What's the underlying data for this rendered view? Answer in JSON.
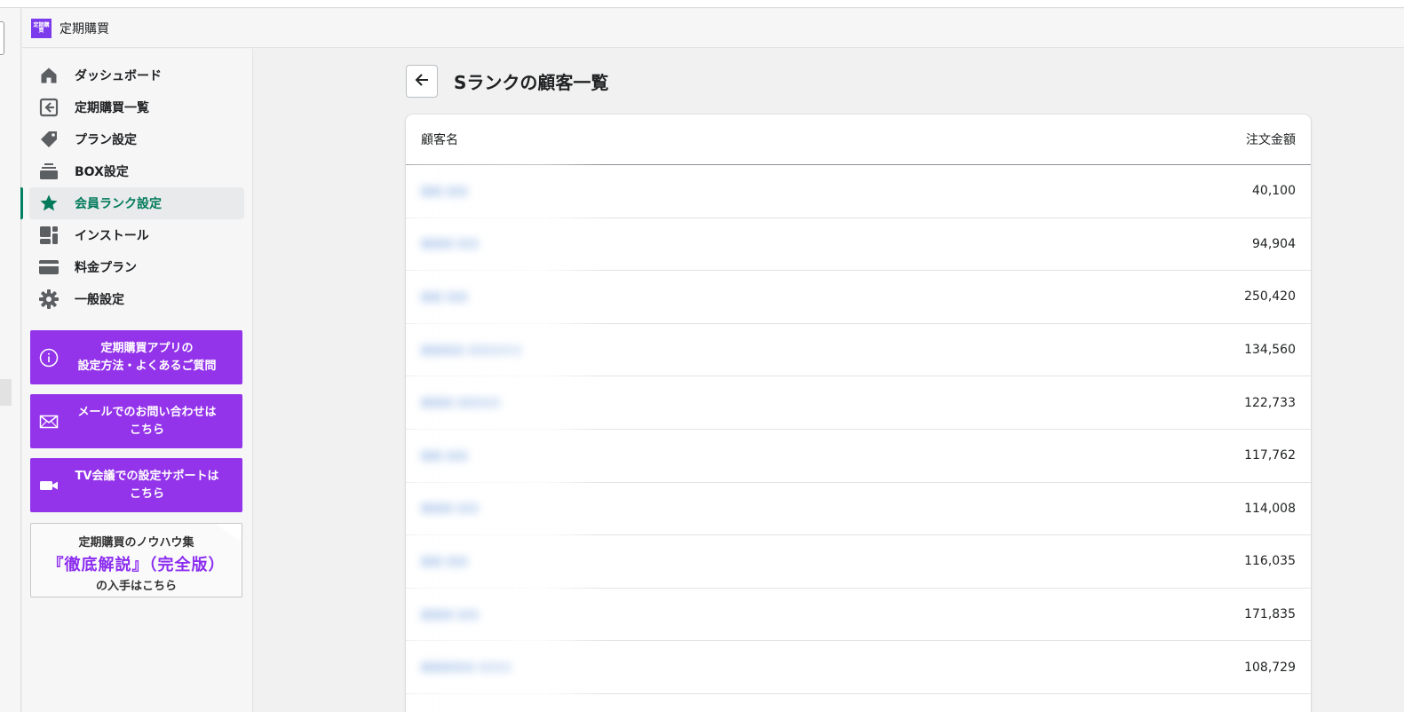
{
  "app": {
    "title": "定期購買",
    "logo_text": "定期購買"
  },
  "nav": {
    "items": [
      {
        "label": "ダッシュボード",
        "icon": "home-icon"
      },
      {
        "label": "定期購買一覧",
        "icon": "subscription-list-icon"
      },
      {
        "label": "プラン設定",
        "icon": "tag-icon"
      },
      {
        "label": "BOX設定",
        "icon": "box-stack-icon"
      },
      {
        "label": "会員ランク設定",
        "icon": "star-icon",
        "active": true
      },
      {
        "label": "インストール",
        "icon": "layout-icon"
      },
      {
        "label": "料金プラン",
        "icon": "credit-card-icon"
      },
      {
        "label": "一般設定",
        "icon": "gear-icon"
      }
    ]
  },
  "promos": {
    "faq": {
      "line1": "定期購買アプリの",
      "line2": "設定方法・よくあるご質問"
    },
    "mail": {
      "line1": "メールでのお問い合わせは",
      "line2": "こちら"
    },
    "tv": {
      "line1": "TV会議での設定サポートは",
      "line2": "こちら"
    },
    "knowhow": {
      "line1": "定期購買のノウハウ集",
      "line2": "『徹底解説』（完全版）",
      "line3": "の入手はこちら"
    }
  },
  "page": {
    "title": "Sランクの顧客一覧"
  },
  "table": {
    "headers": {
      "name": "顧客名",
      "amount": "注文金額"
    },
    "rows": [
      {
        "name": "■■ ■■",
        "amount": "40,100"
      },
      {
        "name": "■■■ ■■",
        "amount": "94,904"
      },
      {
        "name": "■■ ■■",
        "amount": "250,420"
      },
      {
        "name": "■■■■ ■■■■■",
        "amount": "134,560"
      },
      {
        "name": "■■■ ■■■■",
        "amount": "122,733"
      },
      {
        "name": "■■ ■■",
        "amount": "117,762"
      },
      {
        "name": "■■■ ■■",
        "amount": "114,008"
      },
      {
        "name": "■■ ■■",
        "amount": "116,035"
      },
      {
        "name": "■■■ ■■",
        "amount": "171,835"
      },
      {
        "name": "■■■■■ ■■■",
        "amount": "108,729"
      }
    ]
  },
  "colors": {
    "accent_green": "#008060",
    "promo_purple": "#9333ea",
    "link_blue": "#2c6ecb"
  }
}
